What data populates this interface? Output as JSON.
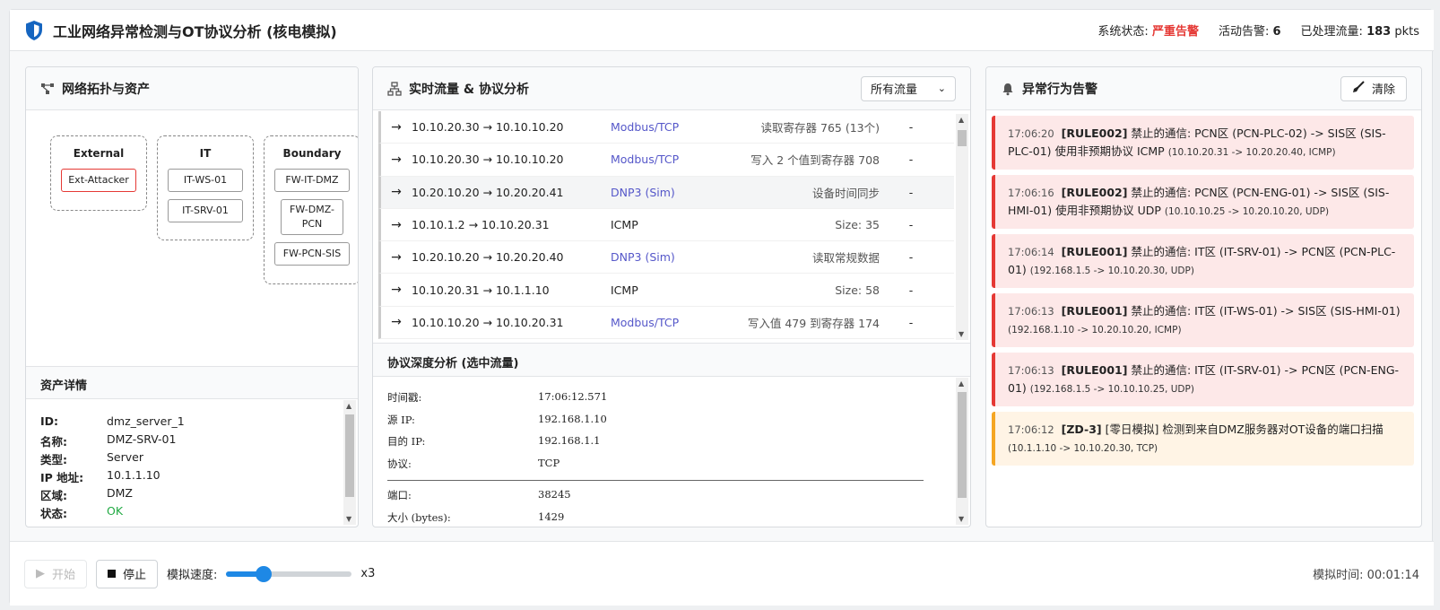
{
  "header": {
    "title": "工业网络异常检测与OT协议分析 (核电模拟)",
    "status_label": "系统状态:",
    "status_value": "严重告警",
    "alerts_label": "活动告警:",
    "alerts_value": "6",
    "traffic_label": "已处理流量:",
    "traffic_value": "183",
    "traffic_unit": "pkts",
    "icon": "shield-icon"
  },
  "topology": {
    "title": "网络拓扑与资产",
    "icon": "topology-icon",
    "zones": [
      {
        "name": "External",
        "nodes": [
          "Ext-Attacker"
        ]
      },
      {
        "name": "IT",
        "nodes": [
          "IT-WS-01",
          "IT-SRV-01"
        ]
      },
      {
        "name": "Boundary",
        "nodes": [
          "FW-IT-DMZ",
          "FW-DMZ-PCN",
          "FW-PCN-SIS"
        ]
      }
    ]
  },
  "asset": {
    "title": "资产详情",
    "rows": [
      {
        "k": "ID:",
        "v": "dmz_server_1"
      },
      {
        "k": "名称:",
        "v": "DMZ-SRV-01"
      },
      {
        "k": "类型:",
        "v": "Server"
      },
      {
        "k": "IP 地址:",
        "v": "10.1.1.10"
      },
      {
        "k": "区域:",
        "v": "DMZ"
      },
      {
        "k": "状态:",
        "v": "OK"
      }
    ]
  },
  "traffic": {
    "title": "实时流量 & 协议分析",
    "icon": "network-icon",
    "filter_value": "所有流量",
    "flows": [
      {
        "addr": "10.10.20.30 → 10.10.10.20",
        "proto": "Modbus/TCP",
        "info": "读取寄存器 765 (13个)",
        "dash": "-"
      },
      {
        "addr": "10.10.20.30 → 10.10.10.20",
        "proto": "Modbus/TCP",
        "info": "写入 2 个值到寄存器 708",
        "dash": "-"
      },
      {
        "addr": "10.20.10.20 → 10.20.20.41",
        "proto": "DNP3 (Sim)",
        "info": "设备时间同步",
        "dash": "-"
      },
      {
        "addr": "10.10.1.2 → 10.10.20.31",
        "proto": "ICMP",
        "info": "Size: 35",
        "dash": "-"
      },
      {
        "addr": "10.20.10.20 → 10.20.20.40",
        "proto": "DNP3 (Sim)",
        "info": "读取常规数据",
        "dash": "-"
      },
      {
        "addr": "10.10.20.31 → 10.1.1.10",
        "proto": "ICMP",
        "info": "Size: 58",
        "dash": "-"
      },
      {
        "addr": "10.10.10.20 → 10.10.20.31",
        "proto": "Modbus/TCP",
        "info": "写入值 479 到寄存器 174",
        "dash": "-"
      }
    ]
  },
  "deep": {
    "title": "协议深度分析 (选中流量)",
    "rows_top": [
      {
        "k": "时间戳:",
        "v": "17:06:12.571"
      },
      {
        "k": "源 IP:",
        "v": "192.168.1.10"
      },
      {
        "k": "目的 IP:",
        "v": "192.168.1.1"
      },
      {
        "k": "协议:",
        "v": "TCP"
      }
    ],
    "rows_bottom": [
      {
        "k": "端口:",
        "v": "38245"
      },
      {
        "k": "大小 (bytes):",
        "v": "1429"
      }
    ]
  },
  "alerts": {
    "title": "异常行为告警",
    "icon": "bell-icon",
    "clear_label": "清除",
    "items": [
      {
        "time": "17:06:20",
        "rule": "[RULE002]",
        "text": "禁止的通信: PCN区 (PCN-PLC-02) -> SIS区 (SIS-PLC-01) 使用非预期协议 ICMP",
        "det": "(10.10.20.31 -> 10.20.20.40, ICMP)",
        "level": "critical"
      },
      {
        "time": "17:06:16",
        "rule": "[RULE002]",
        "text": "禁止的通信: PCN区 (PCN-ENG-01) -> SIS区 (SIS-HMI-01) 使用非预期协议 UDP",
        "det": "(10.10.10.25 -> 10.20.10.20, UDP)",
        "level": "critical"
      },
      {
        "time": "17:06:14",
        "rule": "[RULE001]",
        "text": "禁止的通信: IT区 (IT-SRV-01) -> PCN区 (PCN-PLC-01)",
        "det": "(192.168.1.5 -> 10.10.20.30, UDP)",
        "level": "critical"
      },
      {
        "time": "17:06:13",
        "rule": "[RULE001]",
        "text": "禁止的通信: IT区 (IT-WS-01) -> SIS区 (SIS-HMI-01)",
        "det": "(192.168.1.10 -> 10.20.10.20, ICMP)",
        "level": "critical"
      },
      {
        "time": "17:06:13",
        "rule": "[RULE001]",
        "text": "禁止的通信: IT区 (IT-SRV-01) -> PCN区 (PCN-ENG-01)",
        "det": "(192.168.1.5 -> 10.10.10.25, UDP)",
        "level": "critical"
      },
      {
        "time": "17:06:12",
        "rule": "[ZD-3]",
        "text": "[零日模拟] 检测到来自DMZ服务器对OT设备的端口扫描",
        "det": "(10.1.1.10 -> 10.10.20.30, TCP)",
        "level": "warning"
      }
    ]
  },
  "footer": {
    "start_label": "开始",
    "stop_label": "停止",
    "speed_label": "模拟速度:",
    "speed_value": "x3",
    "speed_fraction": 0.3,
    "sim_time_label": "模拟时间:",
    "sim_time_value": "00:01:14"
  },
  "colors": {
    "critical": "#e53935",
    "warning": "#f5a623",
    "accent": "#1e88e5",
    "protocol": "#5557c9",
    "ok": "#22aa44"
  }
}
